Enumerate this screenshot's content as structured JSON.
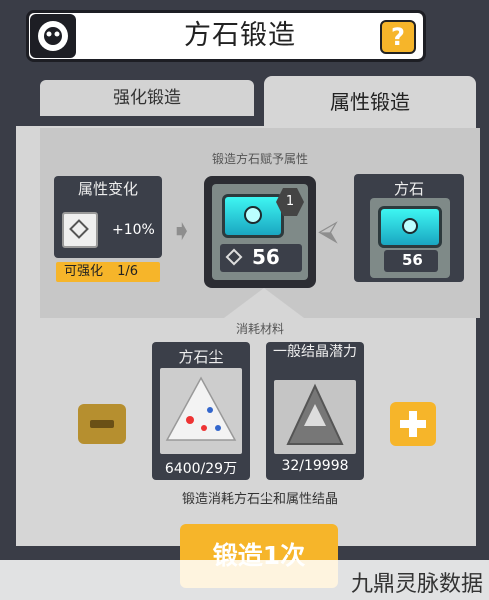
{
  "header": {
    "title": "方石锻造",
    "help_glyph": "?"
  },
  "tabs": [
    {
      "label": "强化锻造",
      "active": false
    },
    {
      "label": "属性锻造",
      "active": true
    }
  ],
  "grant_section": {
    "label": "锻造方石赋予属性"
  },
  "attribute_change": {
    "title": "属性变化",
    "bonus": "+10%",
    "upgrade_label": "可强化",
    "upgrade_progress": "1/6"
  },
  "result_gem": {
    "level_badge": "1",
    "value": "56"
  },
  "source_stone": {
    "title": "方石",
    "value": "56"
  },
  "consume_section": {
    "label": "消耗材料"
  },
  "materials": [
    {
      "title": "方石尘",
      "count": "6400/29万"
    },
    {
      "title": "一般结晶潜力",
      "count": "32/19998"
    }
  ],
  "footer_note": "锻造消耗方石尘和属性结晶",
  "forge_button": "锻造1次",
  "watermark": "九鼎灵脉数据",
  "colors": {
    "accent": "#f6b52a",
    "panel_dark": "#3b3f49",
    "gem": "#3ef6f2"
  }
}
